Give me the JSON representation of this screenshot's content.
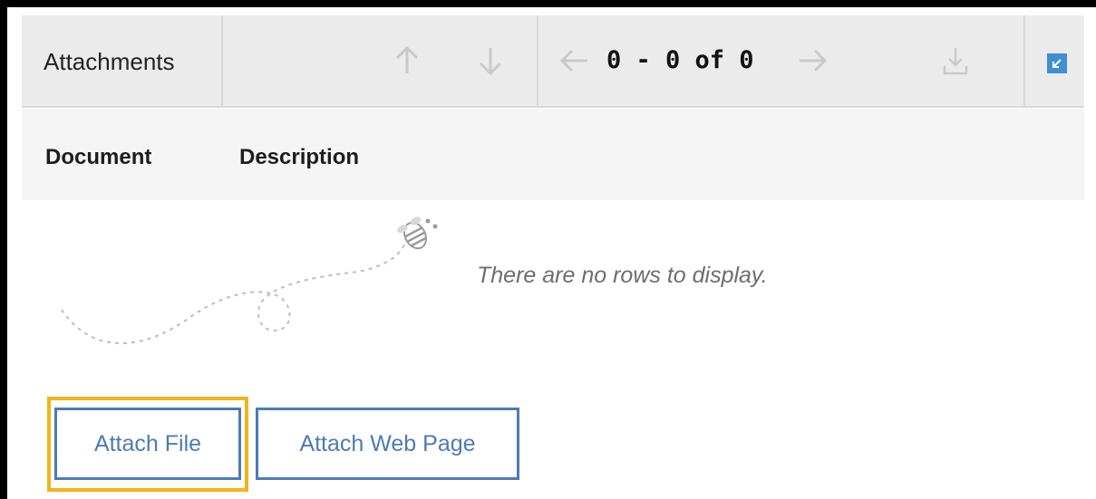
{
  "section": {
    "title": "Attachments"
  },
  "toolbar": {
    "pager_text": "0 - 0 of 0",
    "icons": [
      "arrow-up-icon",
      "arrow-down-icon",
      "arrow-left-icon",
      "arrow-right-icon",
      "download-icon",
      "maximize-icon"
    ],
    "icon_disabled_color": "#c9c9c9",
    "accent_color": "#3f8fd5"
  },
  "table": {
    "columns": [
      "Document",
      "Description"
    ],
    "empty_message": "There are no rows to display."
  },
  "actions": {
    "attach_file_label": "Attach File",
    "attach_web_page_label": "Attach Web Page",
    "button_color": "#4c7bb5",
    "focus_color": "#f2b31b"
  }
}
